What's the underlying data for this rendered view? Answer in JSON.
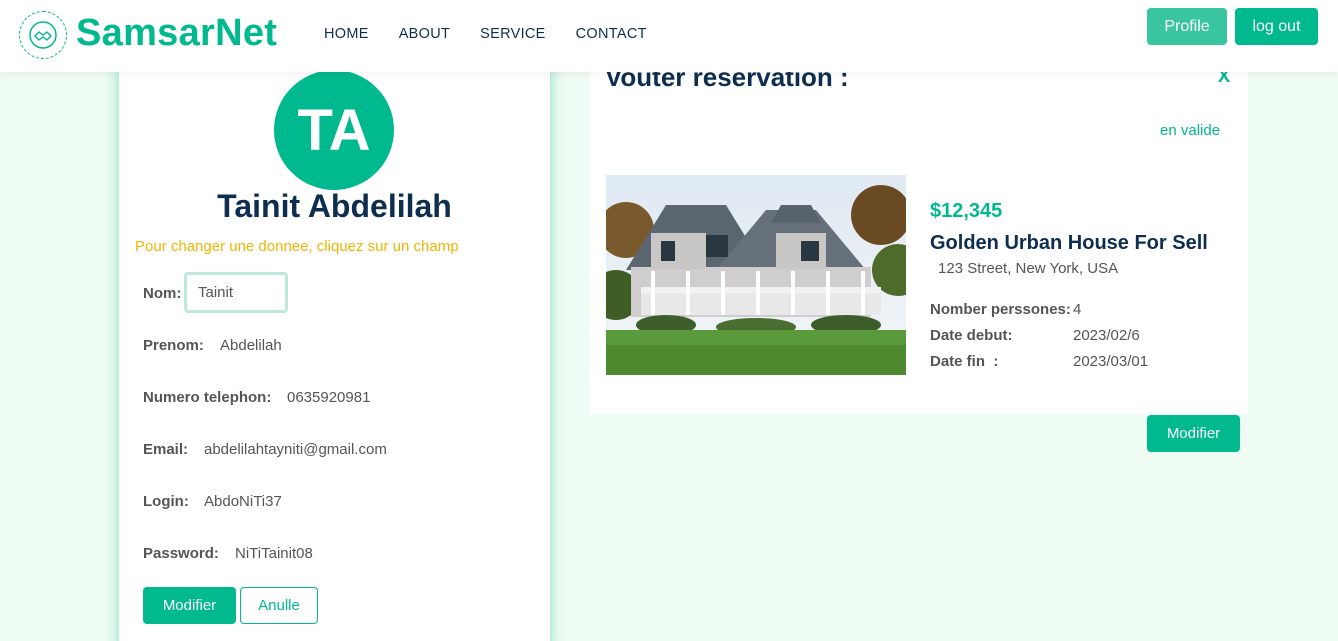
{
  "header": {
    "brand": "SamsarNet",
    "nav": [
      "HOME",
      "ABOUT",
      "SERVICE",
      "CONTACT"
    ],
    "profile_label": "Profile",
    "logout_label": "log out"
  },
  "profile": {
    "initials": "TA",
    "full_name": "Tainit Abdelilah",
    "hint": "Pour changer une donnee, cliquez sur un champ",
    "fields": [
      {
        "label": "Nom:",
        "value": "Tainit"
      },
      {
        "label": "Prenom:",
        "value": "Abdelilah"
      },
      {
        "label": "Numero telephon:",
        "value": "0635920981"
      },
      {
        "label": "Email:",
        "value": "abdelilahtayniti@gmail.com"
      },
      {
        "label": "Login:",
        "value": "AbdoNiTi37"
      },
      {
        "label": "Password:",
        "value": "NiTiTainit08"
      }
    ],
    "modifier_label": "Modifier",
    "annule_label": "Anulle"
  },
  "reservation": {
    "title": "Vouter reservation :",
    "close_label": "X",
    "status": "en valide",
    "price": "$12,345",
    "house_title": "Golden Urban House For Sell",
    "address": "123 Street, New York, USA",
    "details": [
      {
        "label": "Nomber perssones:",
        "value": "4"
      },
      {
        "label": "Date debut:",
        "value": "2023/02/6"
      },
      {
        "label": "Date fin  :",
        "value": "2023/03/01"
      }
    ],
    "modifier_label": "Modifier"
  },
  "colors": {
    "accent": "#00b98e",
    "dark": "#0e2e50",
    "hint": "#f4b400",
    "background": "#effcf3"
  }
}
